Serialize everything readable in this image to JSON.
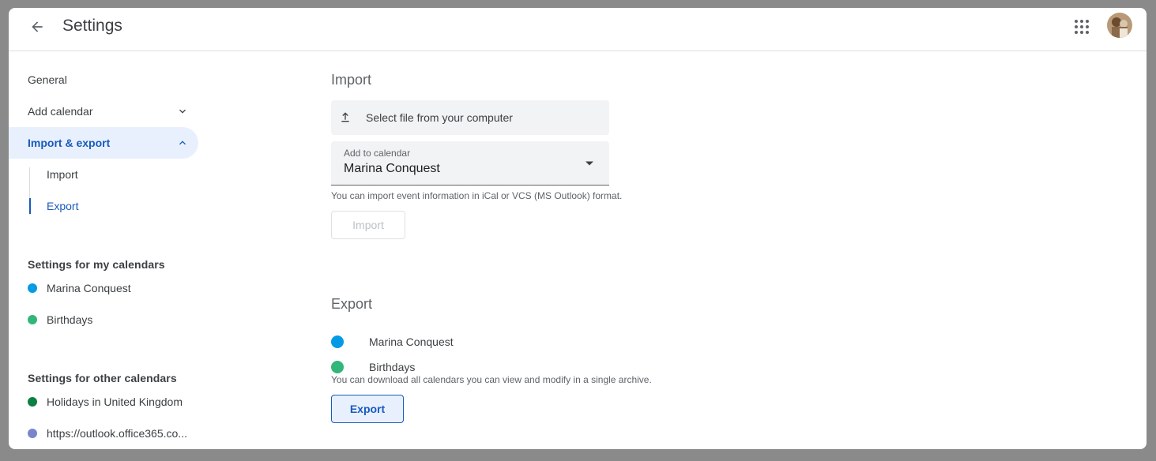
{
  "header": {
    "title": "Settings",
    "back_icon": "arrow-back-icon",
    "apps_icon": "apps-grid-icon"
  },
  "sidebar": {
    "general": "General",
    "add_calendar": "Add calendar",
    "import_export": "Import & export",
    "sub_import": "Import",
    "sub_export": "Export",
    "my_calendars_heading": "Settings for my calendars",
    "my_calendars": [
      {
        "label": "Marina Conquest",
        "color": "#039be5"
      },
      {
        "label": "Birthdays",
        "color": "#33b679"
      }
    ],
    "other_calendars_heading": "Settings for other calendars",
    "other_calendars": [
      {
        "label": "Holidays in United Kingdom",
        "color": "#0b8043"
      },
      {
        "label": "https://outlook.office365.co...",
        "color": "#7986cb"
      }
    ]
  },
  "import": {
    "heading": "Import",
    "select_file": "Select file from your computer",
    "add_to_label": "Add to calendar",
    "add_to_value": "Marina Conquest",
    "help": "You can import event information in iCal or VCS (MS Outlook) format.",
    "button": "Import"
  },
  "export": {
    "heading": "Export",
    "calendars": [
      {
        "label": "Marina Conquest",
        "color": "#039be5"
      },
      {
        "label": "Birthdays",
        "color": "#33b679"
      }
    ],
    "help": "You can download all calendars you can view and modify in a single archive.",
    "button": "Export"
  },
  "colors": {
    "accent": "#185abc",
    "accent_bg": "#e8f0fe"
  }
}
